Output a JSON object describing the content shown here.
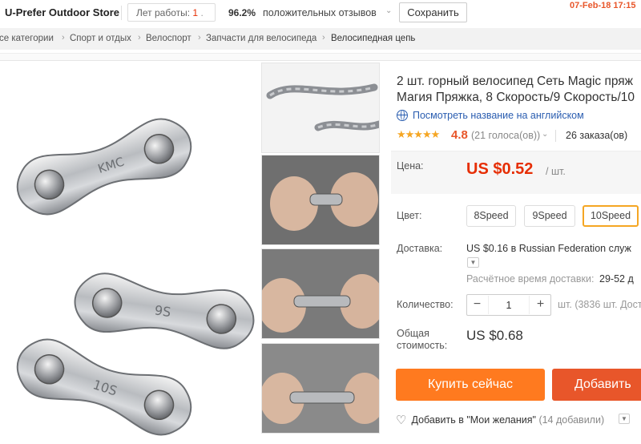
{
  "store": {
    "name": "U-Prefer Outdoor Store",
    "years_label": "Лет работы:",
    "years_value": "1",
    "positive_pct": "96.2%",
    "positive_label": "положительных отзывов",
    "save_label": "Сохранить",
    "date_stamp": "07-Feb-18  17:15"
  },
  "breadcrumb": [
    "се категории",
    "Спорт и отдых",
    "Велоспорт",
    "Запчасти для велосипеда",
    "Велосипедная цепь"
  ],
  "product": {
    "title_line1": "2 шт. горный велосипед Сеть Magic пряж",
    "title_line2": "Магия Пряжка, 8 Скорость/9 Скорость/10",
    "translate_label": "Посмотреть название на английском",
    "stars": "★★★★★",
    "rating": "4.8",
    "votes": "(21 голоса(ов))",
    "orders": "26 заказа(ов)",
    "price_label": "Цена:",
    "price": "US $0.52",
    "per_unit": "/ шт.",
    "color_label": "Цвет:",
    "options": [
      "8Speed",
      "9Speed",
      "10Speed"
    ],
    "selected_option": "10Speed",
    "shipping_label": "Доставка:",
    "shipping_price": "US $0.16",
    "shipping_dest": "в Russian Federation служ",
    "est_label": "Расчётное время доставки:",
    "est_value": "29-52 д",
    "qty_label": "Количество:",
    "qty_value": "1",
    "availability": "шт. (3836 шт. Дост",
    "total_label_1": "Общая",
    "total_label_2": "стоимость:",
    "total_value": "US $0.68",
    "buy_label": "Купить сейчас",
    "cart_label": "Добавить",
    "wish_label": "Добавить в \"Мои желания\"",
    "wish_count": "(14 добавили)"
  },
  "colors": {
    "accent_orange": "#ff7a1f",
    "price_red": "#e62e04",
    "link_blue": "#2a5db0",
    "star_yellow": "#f5a623"
  },
  "icons": {
    "translate": "globe-icon",
    "wishlist": "heart-plus-icon",
    "dropdown": "chevron-down-icon"
  },
  "images": {
    "main_labels": [
      "KMC",
      "9S",
      "10S"
    ]
  }
}
